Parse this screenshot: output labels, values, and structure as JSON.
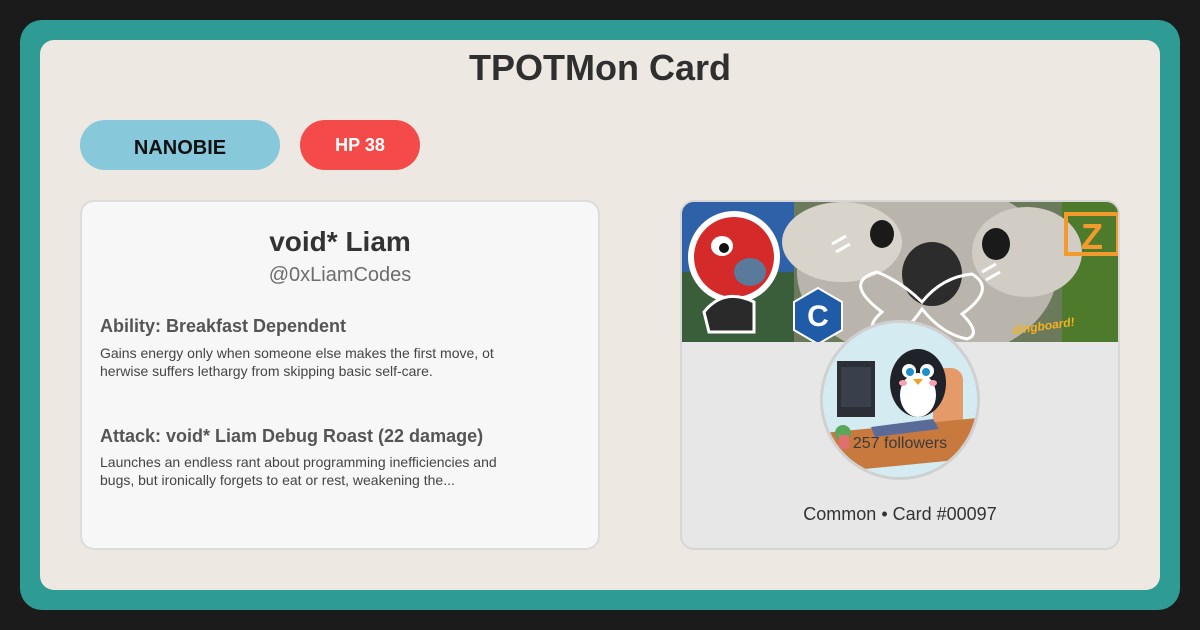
{
  "header": {
    "title": "TPOTMon Card"
  },
  "badges": {
    "type": "NANOBIE",
    "hp": "HP 38"
  },
  "profile": {
    "name": "void* Liam",
    "handle": "@0xLiamCodes",
    "followers": "257 followers",
    "meta": "Common • Card #00097"
  },
  "ability": {
    "title": "Ability: Breakfast Dependent",
    "text": "Gains energy only when someone else makes the first move, otherwise suffers lethargy from skipping basic self-care."
  },
  "attack": {
    "title": "Attack: void* Liam Debug Roast (22 damage)",
    "text": "Launches an endless rant about programming inefficiencies and bugs, but ironically forgets to eat or rest, weakening the..."
  },
  "banner": {
    "sticker_text": "dingboard!",
    "c_logo": "C",
    "z_logo": "Z"
  },
  "colors": {
    "frame": "#2e9b94",
    "card": "#ede9e2",
    "type_badge": "#87c8db",
    "hp_badge": "#f44a4a"
  }
}
